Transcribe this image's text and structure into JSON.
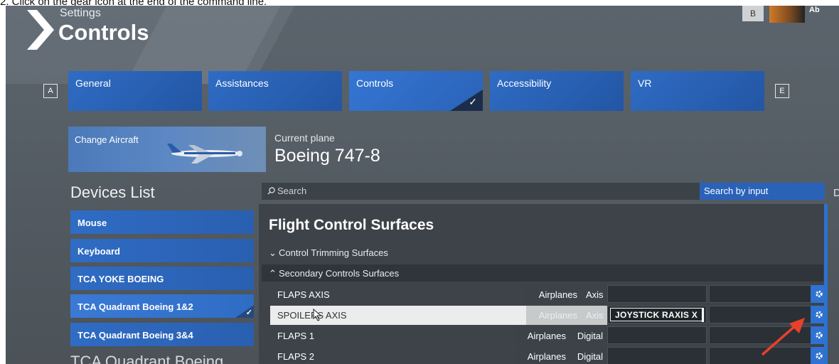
{
  "caption": "2. Click on the gear icon at the end of the command line.",
  "header": {
    "subtitle": "Settings",
    "title": "Controls",
    "topright_key": "B",
    "username": "Ab"
  },
  "nav_keys": {
    "left": "A",
    "right": "E"
  },
  "tabs": [
    {
      "label": "General",
      "active": false
    },
    {
      "label": "Assistances",
      "active": false
    },
    {
      "label": "Controls",
      "active": true
    },
    {
      "label": "Accessibility",
      "active": false
    },
    {
      "label": "VR",
      "active": false
    }
  ],
  "aircraft": {
    "change_label": "Change Aircraft",
    "current_label": "Current plane",
    "current_name": "Boeing 747-8"
  },
  "devices": {
    "title": "Devices List",
    "items": [
      {
        "label": "Mouse",
        "active": false
      },
      {
        "label": "Keyboard",
        "active": false
      },
      {
        "label": "TCA YOKE BOEING",
        "active": false
      },
      {
        "label": "TCA Quadrant Boeing 1&2",
        "active": true
      },
      {
        "label": "TCA Quadrant Boeing 3&4",
        "active": false
      }
    ],
    "partial_heading": "TCA Quadrant Boeing"
  },
  "search": {
    "placeholder": "Search",
    "by_input_label": "Search by input",
    "right_stub": "D"
  },
  "panel": {
    "title": "Flight Control Surfaces",
    "groups": [
      {
        "label": "Control Trimming Surfaces",
        "expanded": false
      },
      {
        "label": "Secondary Controls Surfaces",
        "expanded": true
      }
    ],
    "rows": [
      {
        "name": "FLAPS AXIS",
        "category": "Airplanes",
        "type": "Axis",
        "binding": "",
        "highlight": false
      },
      {
        "name": "SPOILERS AXIS",
        "category": "Airplanes",
        "type": "Axis",
        "binding": "JOYSTICK RAXIS X",
        "highlight": true
      },
      {
        "name": "FLAPS 1",
        "category": "Airplanes",
        "type": "Digital",
        "binding": "",
        "highlight": false
      },
      {
        "name": "FLAPS 2",
        "category": "Airplanes",
        "type": "Digital",
        "binding": "",
        "highlight": false
      }
    ]
  },
  "colors": {
    "accent": "#2f6cc4",
    "arrow": "#e8402a"
  },
  "icons": {
    "gear": "gear-icon",
    "chevron": "chevron-icon",
    "search": "search-icon",
    "check": "check-icon"
  }
}
